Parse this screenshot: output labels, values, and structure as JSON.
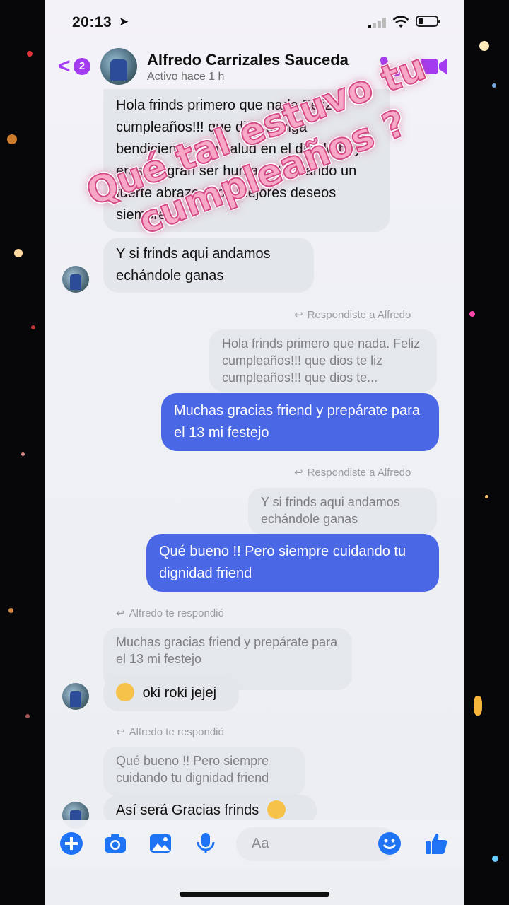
{
  "status_bar": {
    "time": "20:13"
  },
  "header": {
    "unread_count": "2",
    "contact_name": "Alfredo Carrizales Sauceda",
    "active_status": "Activo hace 1 h"
  },
  "overlay_text": "Qué tal estuvo tu cumpleaños ?",
  "messages": {
    "m1": "Hola frinds primero que nada Feliz cumpleaños!!! que dios te siga bendiciendo con salud en el día de hoy eres un gran ser humano te mando un fuerte abrazo y los mejores deseos siempre",
    "m2": "Y  si frinds aqui andamos echándole ganas",
    "reply1_label": "Respondiste a Alfredo",
    "reply1_quote": "Hola frinds primero que nada. Feliz cumpleaños!!! que dios te liz cumpleaños!!! que dios te...",
    "m3": "Muchas gracias friend y prepárate para el 13 mi festejo",
    "reply2_label": "Respondiste a Alfredo",
    "reply2_quote": "Y  si frinds aqui andamos echándole ganas",
    "m4": "Qué bueno !! Pero siempre cuidando tu dignidad friend",
    "reply3_label": "Alfredo te respondió",
    "reply3_quote": "Muchas gracias friend y prepárate para el 13 mi festejo",
    "m5": "oki roki jejej",
    "reply4_label": "Alfredo te respondió",
    "reply4_quote": "Qué bueno !! Pero siempre cuidando tu dignidad friend",
    "m6": "Así será Gracias frinds"
  },
  "composer": {
    "placeholder": "Aa"
  },
  "colors": {
    "accent": "#a33cf0",
    "outgoing": "#4a67e6",
    "messenger_blue": "#1e74f5"
  }
}
